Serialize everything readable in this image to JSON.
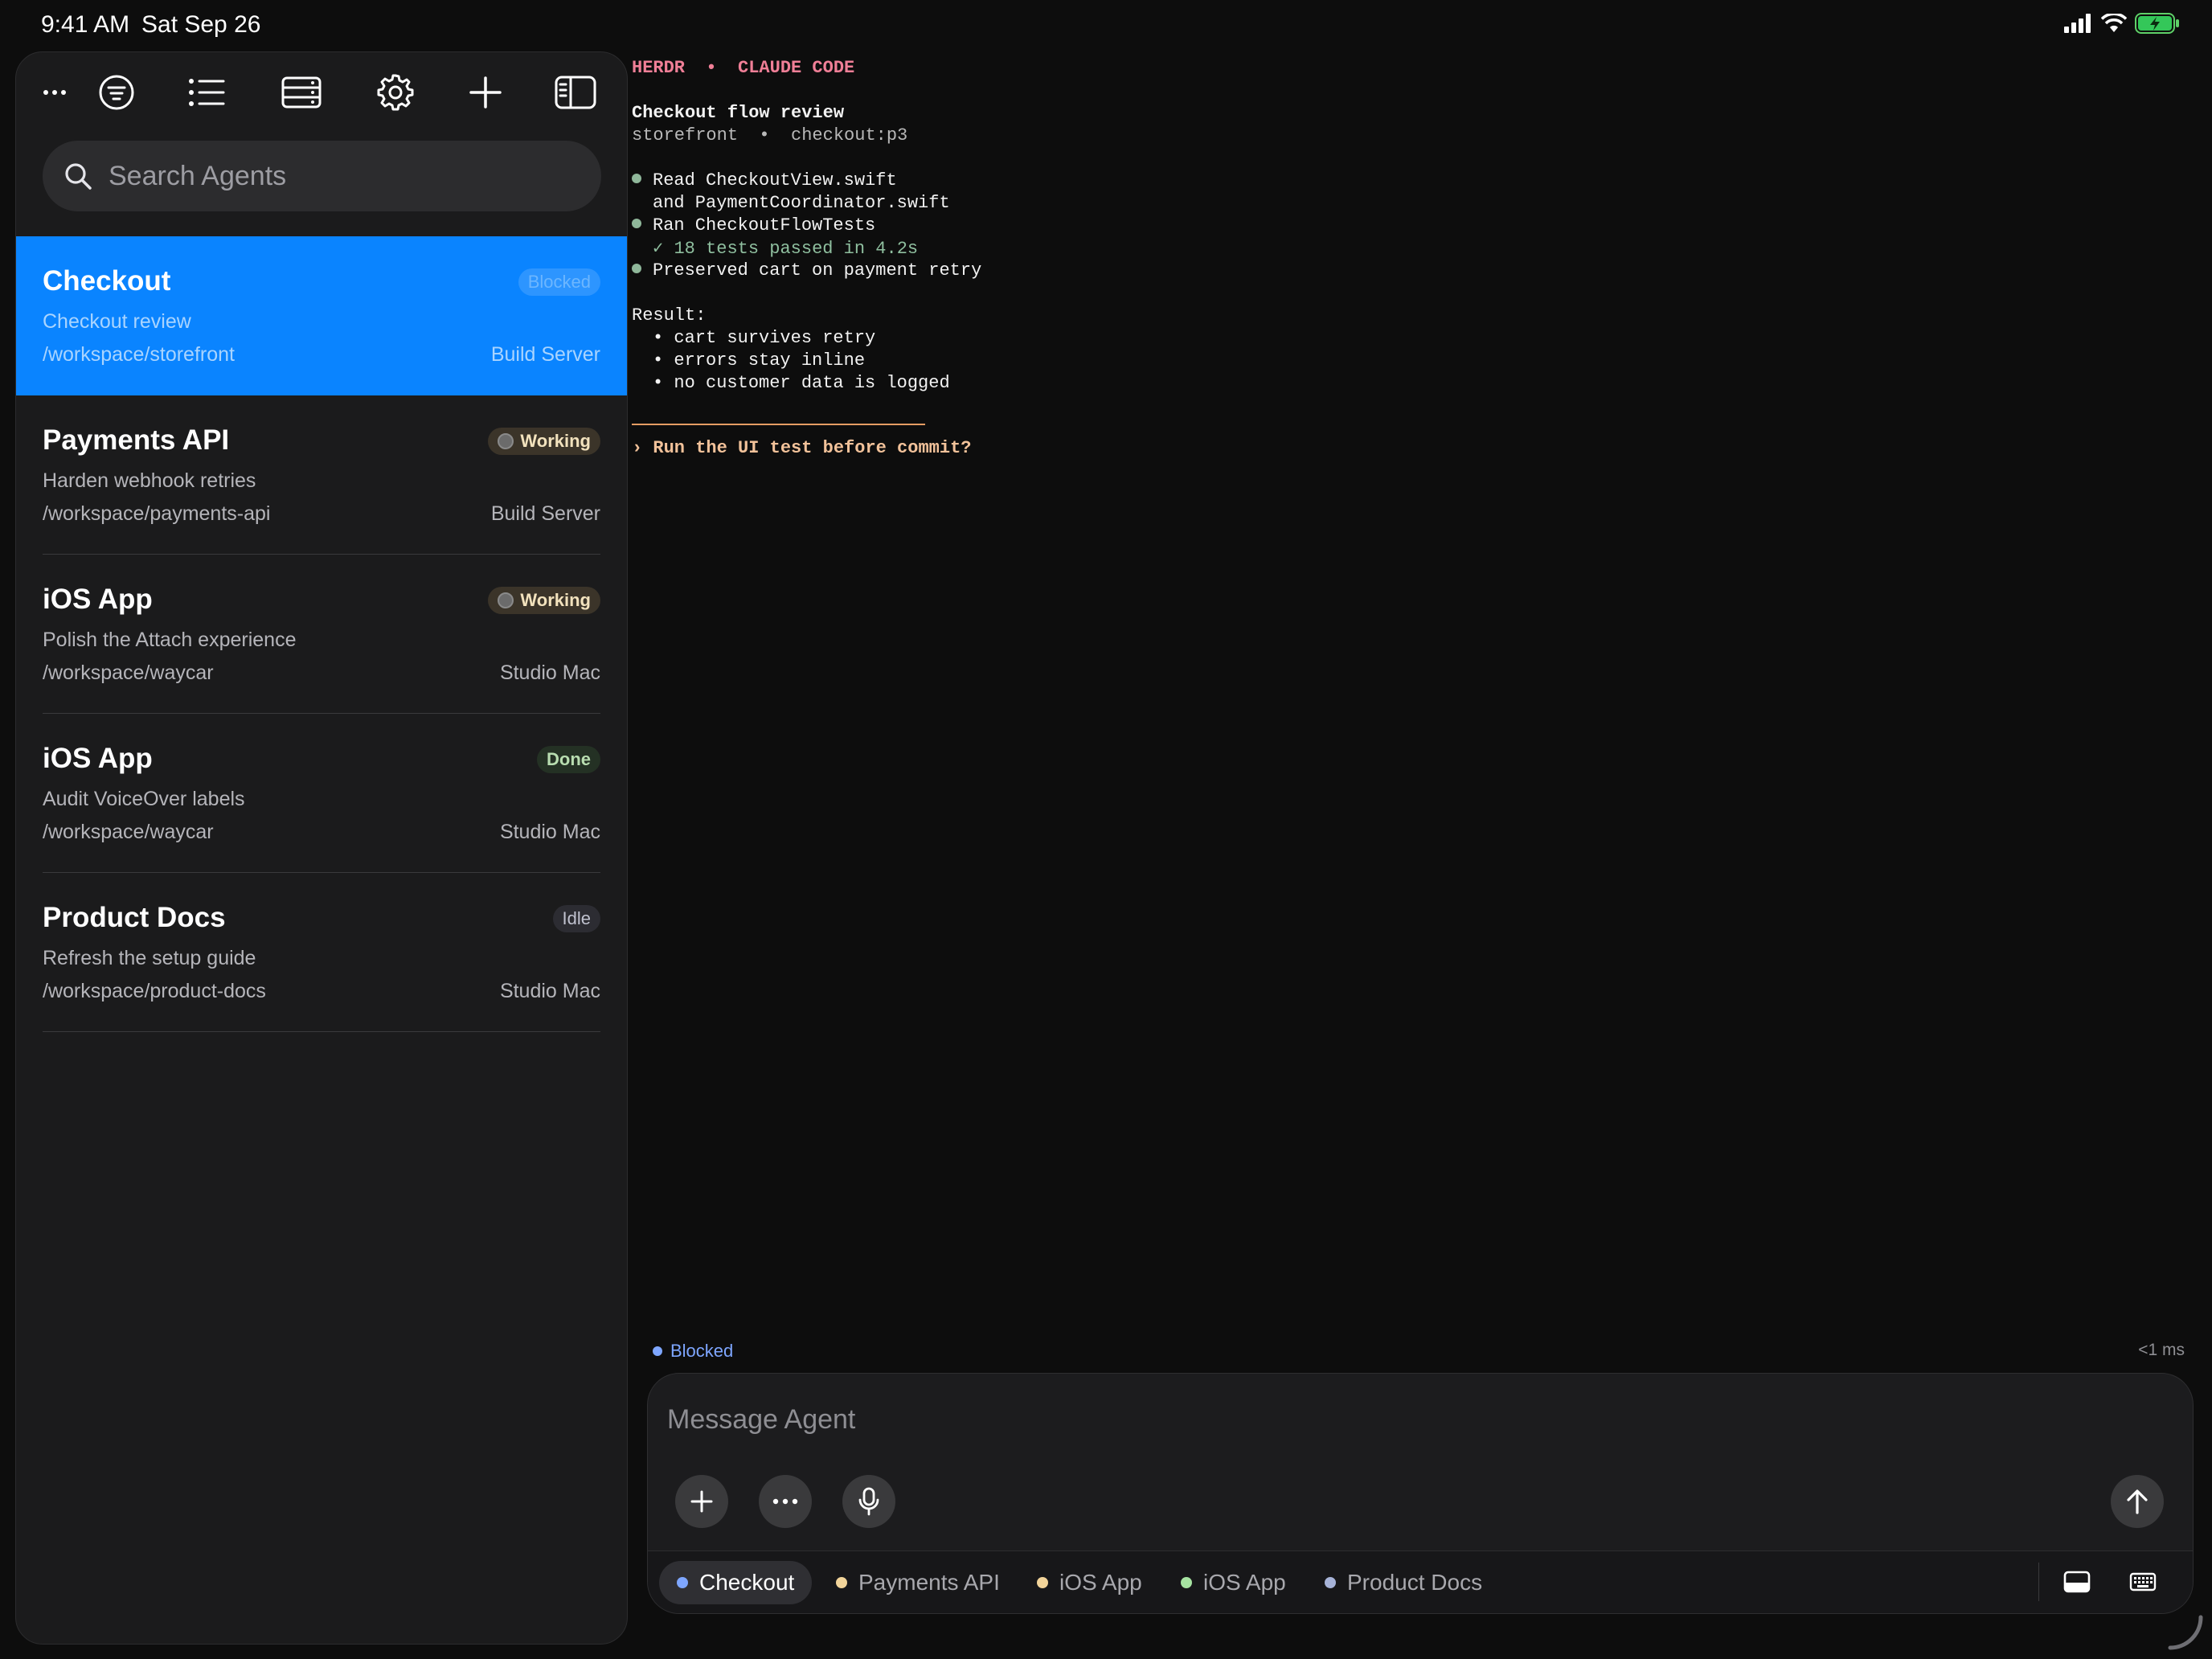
{
  "status_bar": {
    "time": "9:41 AM",
    "date": "Sat Sep 26"
  },
  "toolbar": {
    "buttons": [
      "more-icon",
      "filter-icon",
      "list-icon",
      "server-icon",
      "gear-icon",
      "plus-icon",
      "sidebar-icon"
    ],
    "more_label": "..."
  },
  "search": {
    "placeholder": "Search Agents"
  },
  "agents": [
    {
      "title": "Checkout",
      "subtitle": "Checkout review",
      "path": "/workspace/storefront",
      "host": "Build Server",
      "status": "Blocked",
      "selected": true
    },
    {
      "title": "Payments API",
      "subtitle": "Harden webhook retries",
      "path": "/workspace/payments-api",
      "host": "Build Server",
      "status": "Working"
    },
    {
      "title": "iOS App",
      "subtitle": "Polish the Attach experience",
      "path": "/workspace/waycar",
      "host": "Studio Mac",
      "status": "Working"
    },
    {
      "title": "iOS App",
      "subtitle": "Audit VoiceOver labels",
      "path": "/workspace/waycar",
      "host": "Studio Mac",
      "status": "Done"
    },
    {
      "title": "Product Docs",
      "subtitle": "Refresh the setup guide",
      "path": "/workspace/product-docs",
      "host": "Studio Mac",
      "status": "Idle"
    }
  ],
  "terminal": {
    "header": "HERDR  •  CLAUDE CODE",
    "title": "Checkout flow review",
    "context": "storefront  •  checkout:p3",
    "steps": [
      "Read CheckoutView.swift",
      "and PaymentCoordinator.swift",
      "Ran CheckoutFlowTests",
      "✓ 18 tests passed in 4.2s",
      "Preserved cart on payment retry"
    ],
    "result_label": "Result:",
    "results": [
      "• cart survives retry",
      "• errors stay inline",
      "• no customer data is logged"
    ],
    "prompt": "› Run the UI test before commit?"
  },
  "composer": {
    "status": "Blocked",
    "latency": "<1 ms",
    "placeholder": "Message Agent"
  },
  "tabs": [
    {
      "label": "Checkout",
      "color": "#7ea6ff",
      "active": true
    },
    {
      "label": "Payments API",
      "color": "#f2d49a"
    },
    {
      "label": "iOS App",
      "color": "#f2d49a"
    },
    {
      "label": "iOS App",
      "color": "#a6e3a1"
    },
    {
      "label": "Product Docs",
      "color": "#a7b3d8"
    }
  ],
  "colors": {
    "accent": "#0a84ff",
    "terminal_header": "#f07f97",
    "prompt": "#f2c29a"
  }
}
